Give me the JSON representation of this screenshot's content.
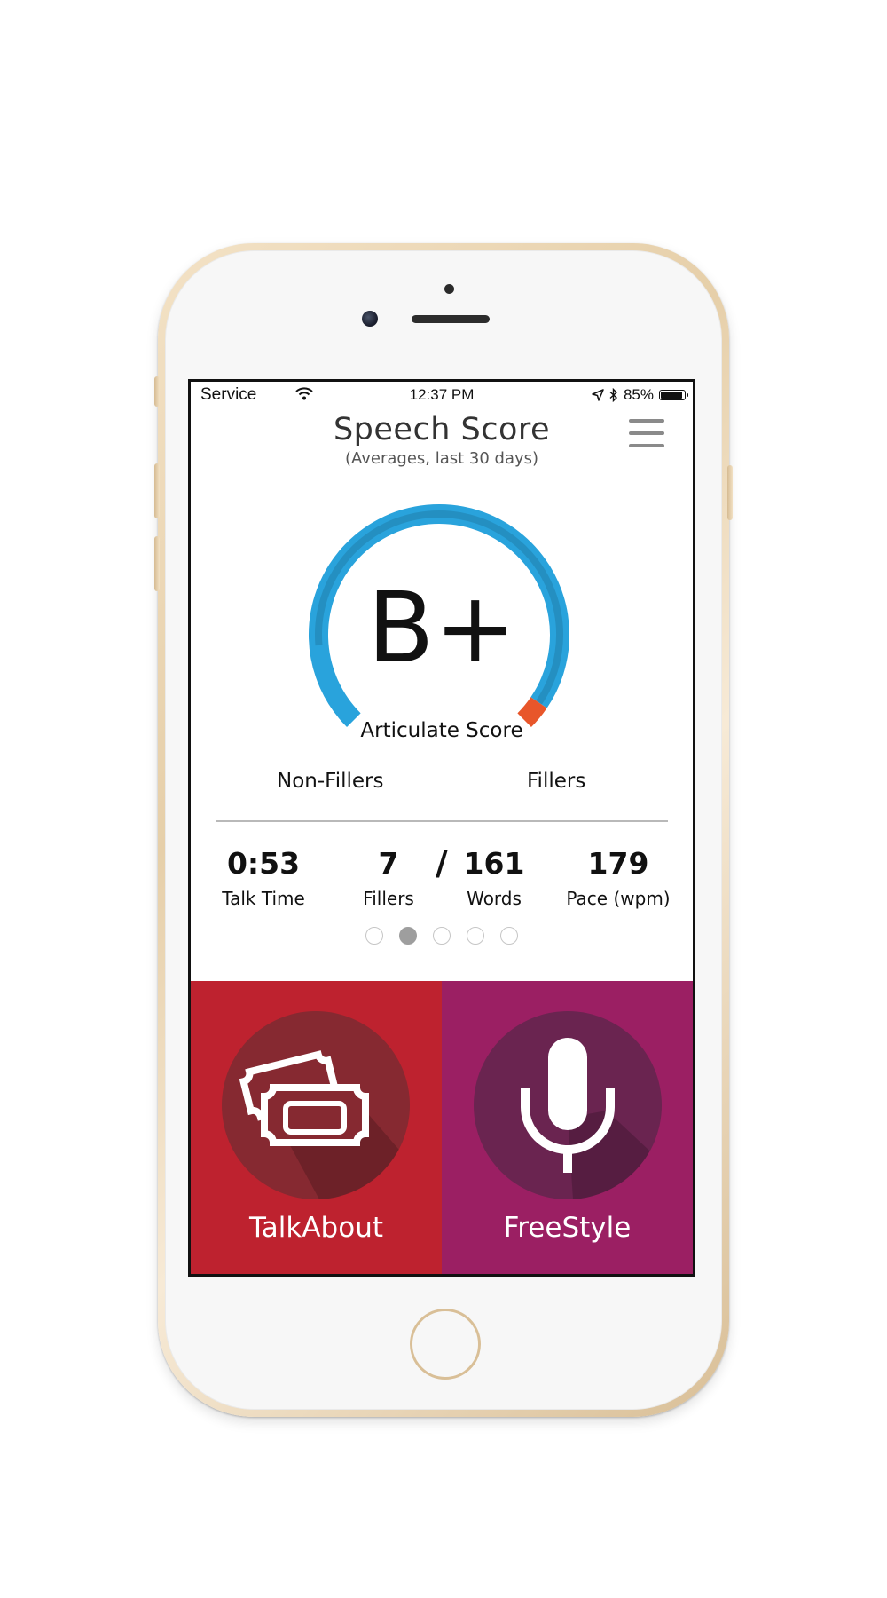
{
  "status_bar": {
    "carrier": "Service",
    "time": "12:37 PM",
    "battery": "85%"
  },
  "header": {
    "title": "Speech Score",
    "subtitle": "(Averages, last 30 days)"
  },
  "score": {
    "grade": "B+",
    "label": "Articulate Score",
    "non_fillers_label": "Non-Fillers",
    "fillers_label": "Fillers",
    "filler_share": 0.04,
    "colors": {
      "non_fillers": "#29a3dc",
      "fillers": "#e8562a"
    }
  },
  "stats": {
    "talk_time": {
      "value": "0:53",
      "label": "Talk Time"
    },
    "fillers": {
      "value": "7",
      "label": "Fillers"
    },
    "separator": "/",
    "words": {
      "value": "161",
      "label": "Words"
    },
    "pace": {
      "value": "179",
      "label": "Pace (wpm)"
    }
  },
  "pager": {
    "count": 5,
    "active_index": 1
  },
  "modes": [
    {
      "label": "TalkAbout",
      "icon": "tickets-icon",
      "color": "#be222f"
    },
    {
      "label": "FreeStyle",
      "icon": "microphone-icon",
      "color": "#9b1f63"
    }
  ]
}
